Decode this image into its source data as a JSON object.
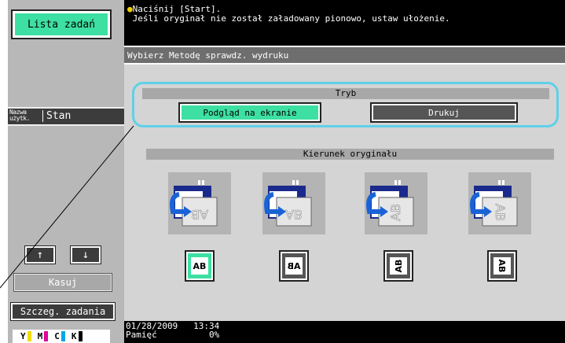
{
  "left": {
    "job_list_label": "Lista zadań",
    "col_user_label": "Nazwa użytk.",
    "col_status_label": "Stan",
    "up_label": "↑",
    "down_label": "↓",
    "delete_label": "Kasuj",
    "job_details_label": "Szczeg. zadania",
    "toner": [
      {
        "letter": "Y",
        "color": "#f2dc00"
      },
      {
        "letter": "M",
        "color": "#e0009a"
      },
      {
        "letter": "C",
        "color": "#00a8e8"
      },
      {
        "letter": "K",
        "color": "#000000"
      }
    ]
  },
  "message": {
    "line1": "Naciśnij [Start].",
    "line2": "Jeśli oryginał nie został załadowany pionowo, ustaw ułożenie."
  },
  "main": {
    "title": "Wybierz Metodę sprawdz. wydruku",
    "mode_header": "Tryb",
    "mode_options": [
      {
        "label": "Podgląd na ekranie",
        "selected": true
      },
      {
        "label": "Drukuj",
        "selected": false
      }
    ],
    "orientation_header": "Kierunek oryginału",
    "orientations": [
      {
        "glyph": "AB",
        "selected": true
      },
      {
        "glyph": "AB",
        "selected": false
      },
      {
        "glyph": "AB",
        "selected": false
      },
      {
        "glyph": "AB",
        "selected": false
      }
    ]
  },
  "status": {
    "date": "01/28/2009",
    "time": "13:34",
    "memory_label": "Pamięć",
    "memory_value": "0%"
  },
  "colors": {
    "accent_green": "#3de0a2",
    "highlight_cyan": "#5fd0e8",
    "panel_gray": "#d4d4d4",
    "icon_blue": "#1a63d6"
  }
}
